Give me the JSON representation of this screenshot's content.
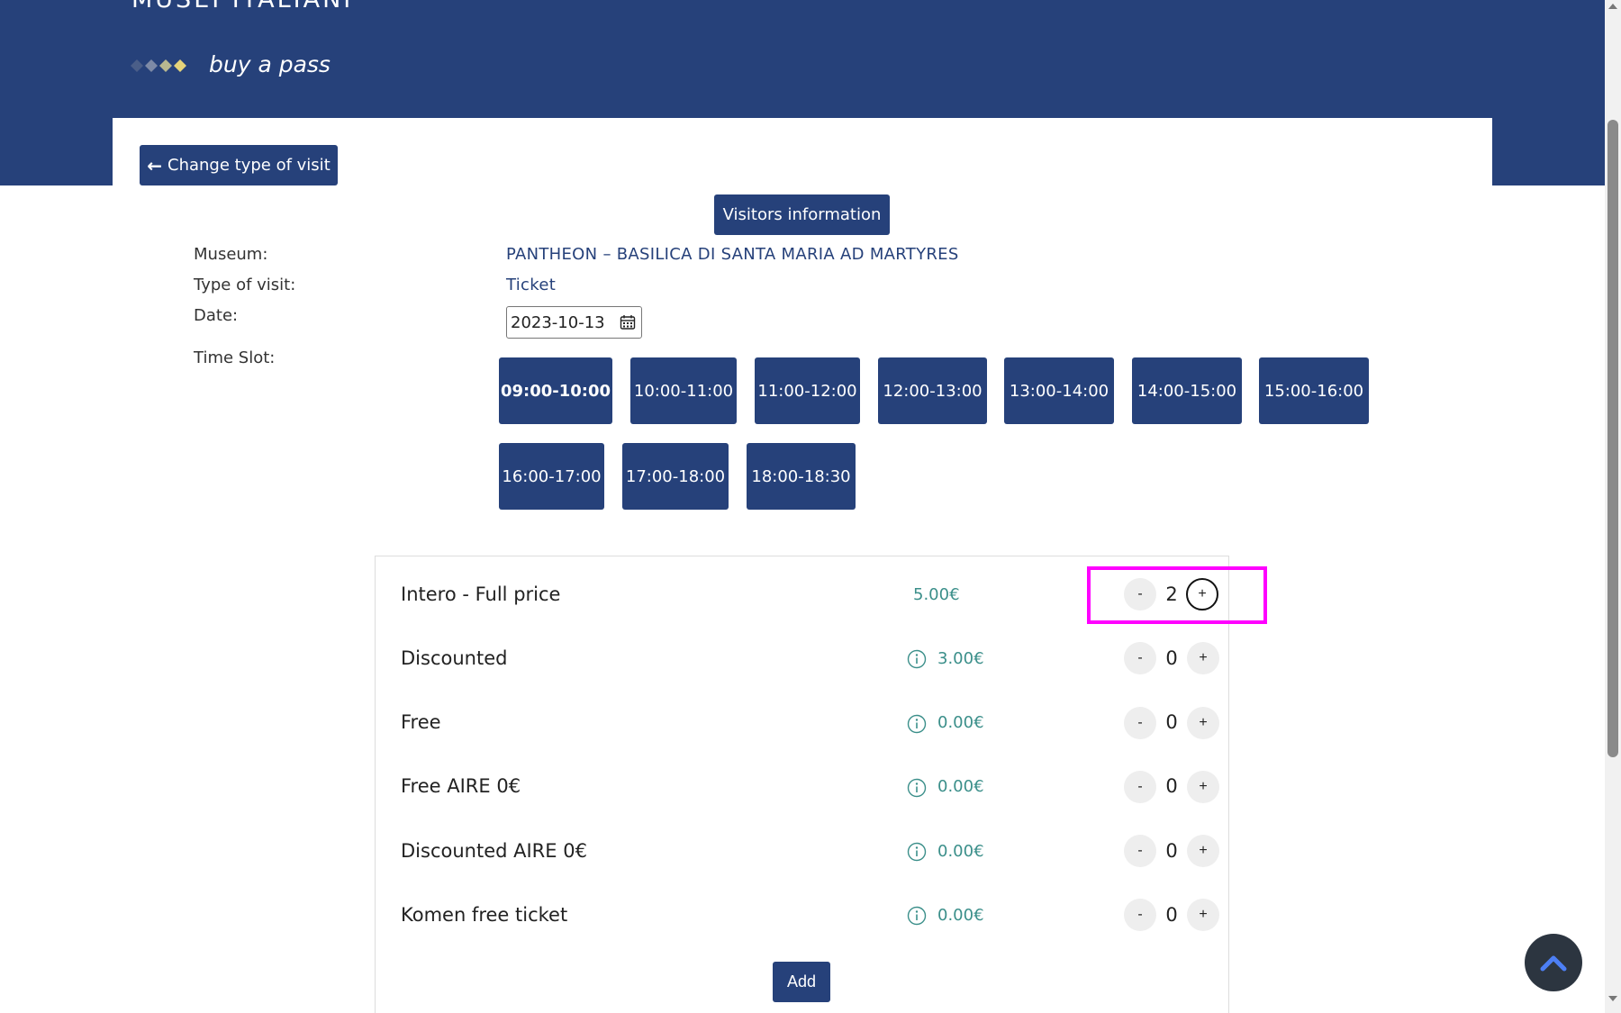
{
  "header": {
    "site_title": "MUSEI ITALIANI",
    "tagline": "buy a pass"
  },
  "nav": {
    "change_visit_label": "Change type of visit",
    "visitors_info_label": "Visitors information"
  },
  "details": {
    "museum_label": "Museum:",
    "museum_value": "PANTHEON – BASILICA DI SANTA MARIA AD MARTYRES",
    "type_label": "Type of visit:",
    "type_value": "Ticket",
    "date_label": "Date:",
    "date_value": "2023-10-13",
    "timeslot_label": "Time Slot:"
  },
  "time_slots": {
    "selected": "09:00-10:00",
    "items": [
      "09:00-10:00",
      "10:00-11:00",
      "11:00-12:00",
      "12:00-13:00",
      "13:00-14:00",
      "14:00-15:00",
      "15:00-16:00",
      "16:00-17:00",
      "17:00-18:00",
      "18:00-18:30"
    ]
  },
  "tickets": [
    {
      "name": "Intero -  Full price",
      "price": "5.00€",
      "qty": "2",
      "has_info": false
    },
    {
      "name": "Discounted",
      "price": "3.00€",
      "qty": "0",
      "has_info": true
    },
    {
      "name": "Free",
      "price": "0.00€",
      "qty": "0",
      "has_info": true
    },
    {
      "name": "Free AIRE 0€",
      "price": "0.00€",
      "qty": "0",
      "has_info": true
    },
    {
      "name": "Discounted AIRE 0€",
      "price": "0.00€",
      "qty": "0",
      "has_info": true
    },
    {
      "name": "Komen free ticket",
      "price": "0.00€",
      "qty": "0",
      "has_info": true
    }
  ],
  "qty_controls": {
    "minus": "-",
    "plus": "+"
  },
  "add_label": "Add",
  "colors": {
    "brand_navy": "#26417a",
    "price_teal": "#3b8f8a",
    "highlight": "#ff00ff",
    "gold": "#e5d37a"
  },
  "icons": {
    "back": "arrow-left-icon",
    "calendar": "calendar-icon",
    "info": "info-icon",
    "scroll_top": "chevron-up-icon"
  }
}
